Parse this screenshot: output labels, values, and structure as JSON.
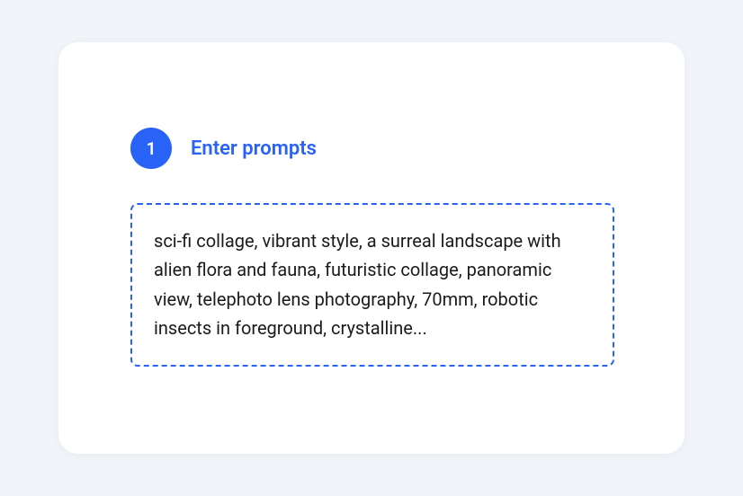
{
  "step": {
    "number": "1",
    "title": "Enter prompts"
  },
  "prompt": {
    "text": "sci-fi collage, vibrant style, a surreal landscape with alien flora and fauna, futuristic collage, panoramic view, telephoto lens photography, 70mm, robotic insects in foreground, crystalline..."
  }
}
